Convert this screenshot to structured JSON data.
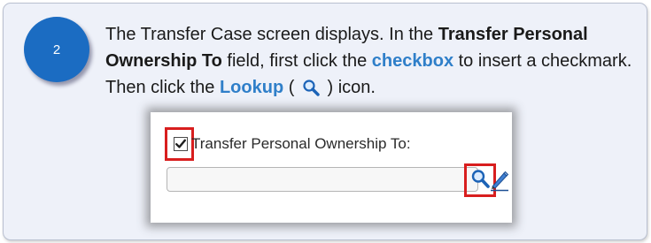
{
  "step": {
    "number": "2"
  },
  "instructions": {
    "part1": "The Transfer Case screen displays. In the ",
    "field_name": "Transfer Personal Ownership To",
    "part2": " field, first click the ",
    "checkbox_word": "checkbox",
    "part3": " to insert a checkmark. Then click the ",
    "lookup_word": "Lookup",
    "part4": " ( ",
    "part5": " ) icon."
  },
  "screenshot": {
    "checkbox_label": "Transfer Personal Ownership To:",
    "checkbox_checked": true,
    "input_value": "",
    "icons": [
      "checkbox-icon",
      "lookup-icon",
      "pencil-icon"
    ]
  },
  "colors": {
    "badge": "#1b6cc2",
    "highlight_text": "#2f7fc9",
    "callout_box": "#d81e1e",
    "card_background": "#eef1f9"
  }
}
